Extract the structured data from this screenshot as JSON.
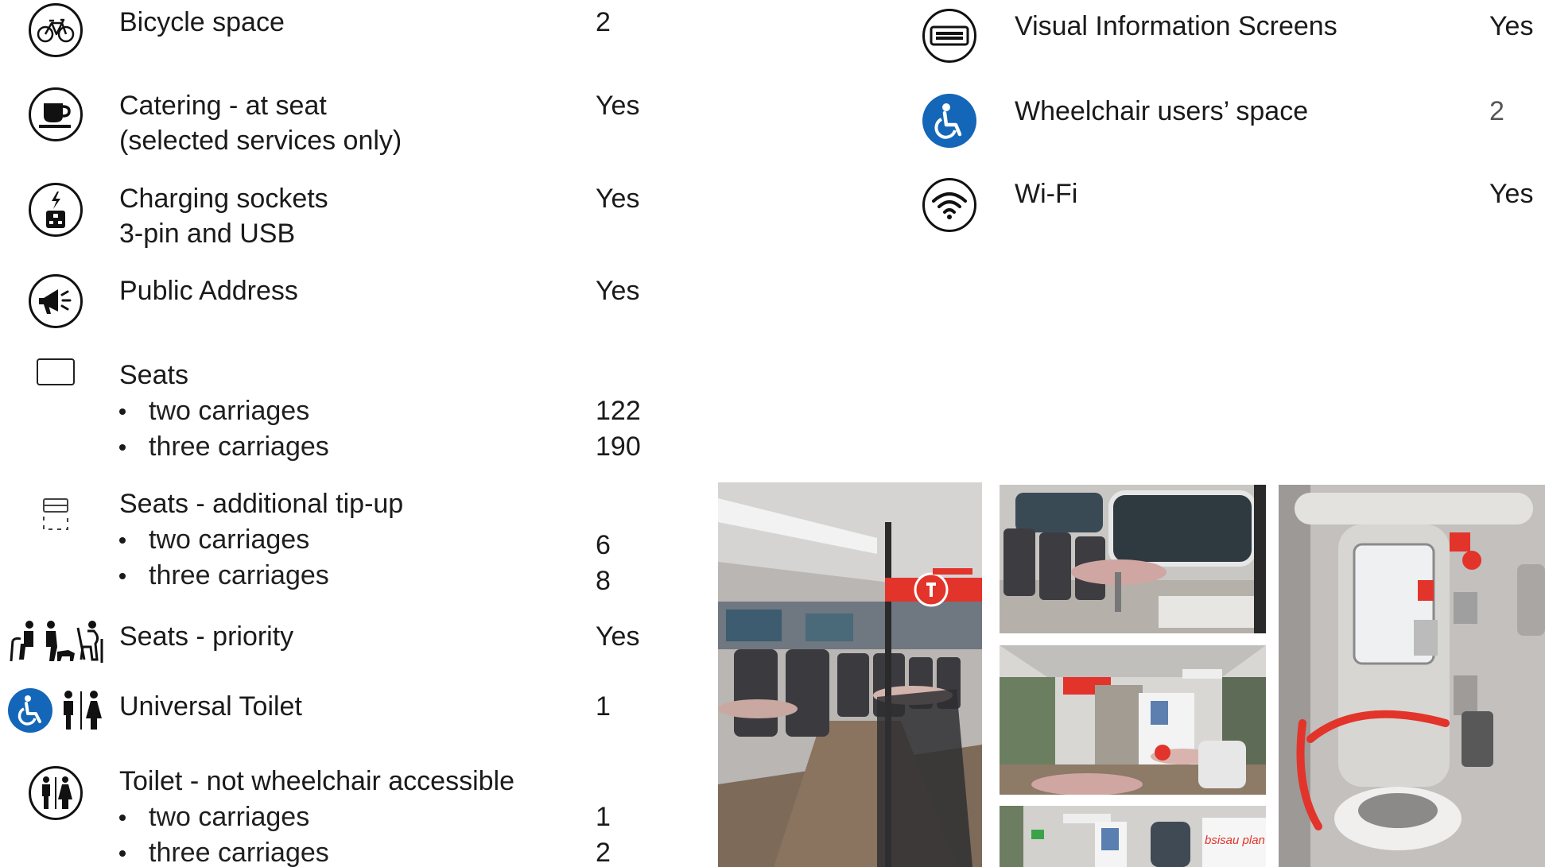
{
  "left_rows": {
    "bicycle": {
      "icon": "bicycle-icon",
      "label": "Bicycle space",
      "value": "2"
    },
    "catering": {
      "icon": "coffee-cup-icon",
      "label": "Catering - at seat",
      "sublabel": "(selected services only)",
      "value": "Yes"
    },
    "charging": {
      "icon": "charging-socket-icon",
      "label": "Charging sockets",
      "sublabel": "3-pin and USB",
      "value": "Yes"
    },
    "pa": {
      "icon": "megaphone-icon",
      "label": "Public Address",
      "value": "Yes"
    },
    "seats": {
      "icon": "seat-outline-icon",
      "label": "Seats",
      "items": [
        {
          "text": "two carriages",
          "value": "122"
        },
        {
          "text": "three carriages",
          "value": "190"
        }
      ]
    },
    "tipup": {
      "icon": "tip-up-seat-icon",
      "label": "Seats - additional tip-up",
      "items": [
        {
          "text": "two carriages",
          "value": "6"
        },
        {
          "text": "three carriages",
          "value": "8"
        }
      ]
    },
    "priority": {
      "icon": "priority-seat-icon",
      "label": "Seats - priority",
      "value": "Yes"
    },
    "universal": {
      "icon": "wheelchair-toilet-icon",
      "label": "Universal Toilet",
      "value": "1"
    },
    "toilet": {
      "icon": "toilet-people-icon",
      "label": "Toilet - not wheelchair accessible",
      "items": [
        {
          "text": "two carriages",
          "value": "1"
        },
        {
          "text": "three carriages",
          "value": "2"
        }
      ]
    }
  },
  "right_rows": {
    "screens": {
      "icon": "information-screen-icon",
      "label": "Visual Information Screens",
      "value": "Yes"
    },
    "wheelchair": {
      "icon": "wheelchair-icon",
      "label": "Wheelchair users’ space",
      "value": "2"
    },
    "wifi": {
      "icon": "wifi-icon",
      "label": "Wi-Fi",
      "value": "Yes"
    }
  },
  "photos": [
    {
      "name": "photo-train-aisle"
    },
    {
      "name": "photo-table-seating"
    },
    {
      "name": "photo-vestibule"
    },
    {
      "name": "photo-door-area"
    },
    {
      "name": "photo-universal-toilet"
    }
  ],
  "colors": {
    "accent_blue": "#1466b8",
    "seat_red": "#e2342b",
    "text": "#1a1a1a"
  }
}
